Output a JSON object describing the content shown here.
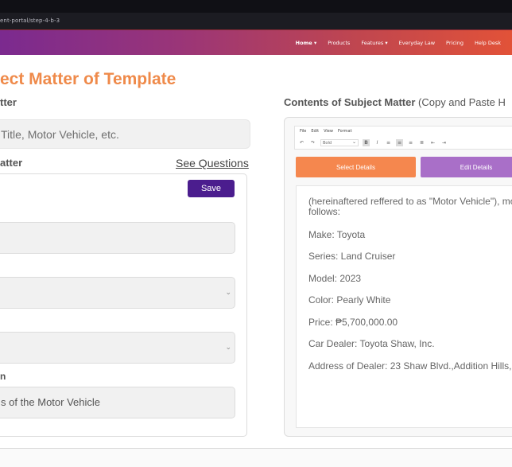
{
  "browser": {
    "url": "ent-portal/step-4-b-3"
  },
  "nav": {
    "items": [
      {
        "label": "Home ▾",
        "active": true
      },
      {
        "label": "Products",
        "active": false
      },
      {
        "label": "Features ▾",
        "active": false
      },
      {
        "label": "Everyday Law",
        "active": false
      },
      {
        "label": "Pricing",
        "active": false
      },
      {
        "label": "Help Desk",
        "active": false
      }
    ]
  },
  "page": {
    "title": "ect Matter of Template"
  },
  "left": {
    "subject_label": "tter",
    "title_placeholder": " Title, Motor Vehicle, etc.",
    "matter_label": "atter",
    "see_questions": "See Questions",
    "save_label": "Save",
    "m_label": "n",
    "last_field_value": "s of the Motor Vehicle"
  },
  "right": {
    "heading_bold": "Contents of Subject Matter",
    "heading_rest": " (Copy and Paste H",
    "editor": {
      "menu": [
        "File",
        "Edit",
        "View",
        "Format"
      ],
      "format_select": "Bold"
    },
    "select_details": "Select Details",
    "edit_details": "Edit Details",
    "content": {
      "intro": "(hereinaftered reffered to as \"Motor Vehicle\"), mo as follows:",
      "lines": [
        "Make: Toyota",
        "Series: Land Cruiser",
        "Model: 2023",
        "Color: Pearly White",
        "Price: ₱5,700,000.00",
        "Car Dealer: Toyota Shaw, Inc.",
        "Address of Dealer: 23 Shaw Blvd.,Addition Hills,"
      ]
    }
  },
  "colors": {
    "accent_orange": "#f5874e",
    "accent_purple": "#4b1d8e",
    "edit_purple": "#a96fc8",
    "title_orange": "#ef8a4a"
  }
}
